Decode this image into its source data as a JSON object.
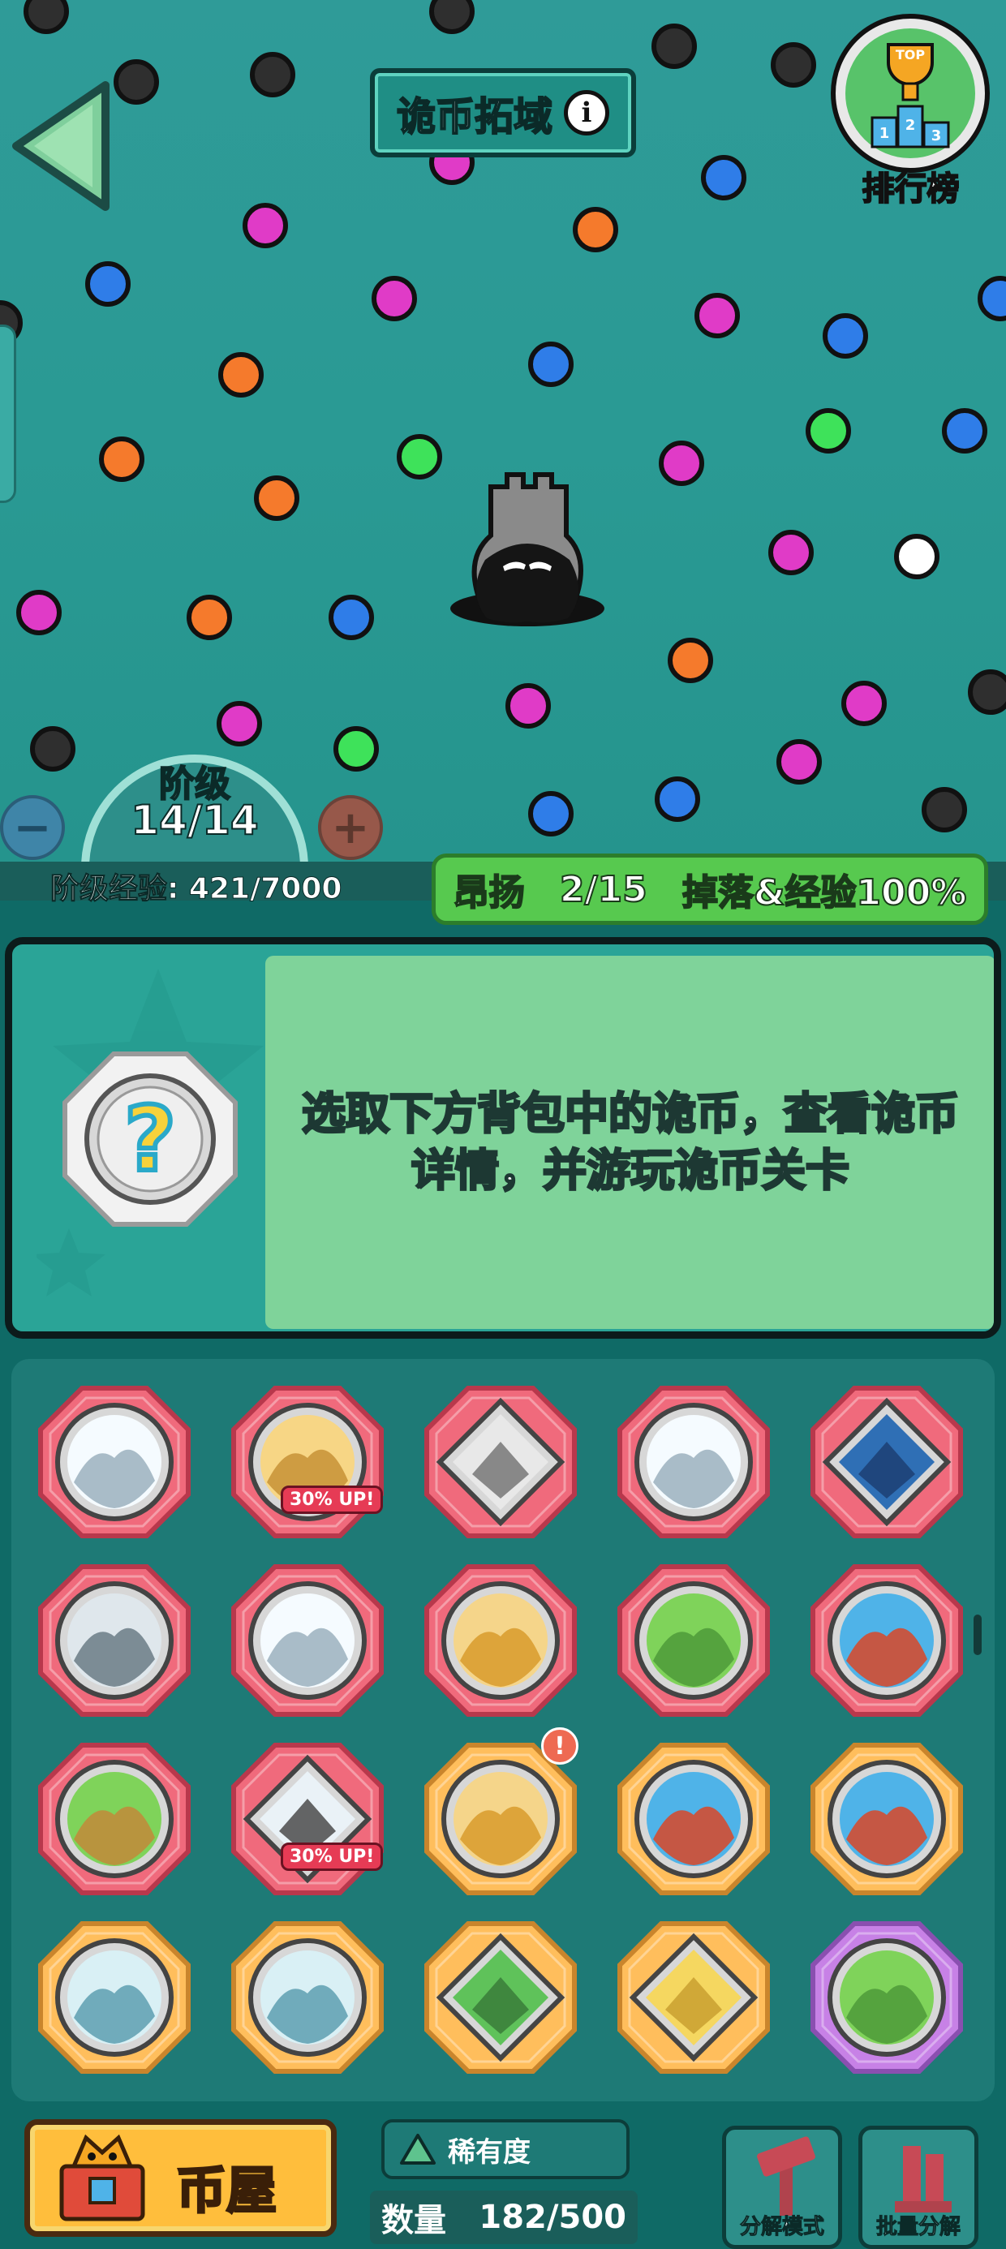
{
  "header": {
    "title": "诡币拓域",
    "leaderboard_label": "排行榜",
    "leaderboard_badge": "TOP",
    "podium_numbers": [
      "1",
      "2",
      "3"
    ]
  },
  "stage": {
    "label": "阶级",
    "value": "14/14",
    "exp_text": "阶级经验: 421/7000",
    "exp_current": 421,
    "exp_max": 7000
  },
  "buff": {
    "name": "昂扬",
    "progress": "2/15",
    "effect": "掉落&经验100%"
  },
  "info_panel": {
    "prompt": "选取下方背包中的诡币，查看诡币详情，并游玩诡币关卡"
  },
  "coins": [
    {
      "theme": "snow-tower",
      "rarity": "red",
      "shape": "circle",
      "badge": "",
      "alert": ""
    },
    {
      "theme": "sphinx",
      "rarity": "red",
      "shape": "circle",
      "badge": "30% UP!",
      "alert": ""
    },
    {
      "theme": "ruined-building",
      "rarity": "red",
      "shape": "diamond",
      "badge": "",
      "alert": ""
    },
    {
      "theme": "snow-tower",
      "rarity": "red",
      "shape": "circle",
      "badge": "",
      "alert": ""
    },
    {
      "theme": "flooded-city",
      "rarity": "red",
      "shape": "diamond",
      "badge": "",
      "alert": ""
    },
    {
      "theme": "graveyard-tower",
      "rarity": "red",
      "shape": "circle",
      "badge": "",
      "alert": ""
    },
    {
      "theme": "snow-tower",
      "rarity": "red",
      "shape": "circle",
      "badge": "",
      "alert": ""
    },
    {
      "theme": "pyramids",
      "rarity": "red",
      "shape": "circle",
      "badge": "",
      "alert": ""
    },
    {
      "theme": "grassland",
      "rarity": "red",
      "shape": "circle",
      "badge": "",
      "alert": ""
    },
    {
      "theme": "volcano",
      "rarity": "red",
      "shape": "circle",
      "badge": "",
      "alert": ""
    },
    {
      "theme": "scarecrow-field",
      "rarity": "red",
      "shape": "circle",
      "badge": "",
      "alert": ""
    },
    {
      "theme": "snowy-gallows",
      "rarity": "red",
      "shape": "diamond",
      "badge": "30% UP!",
      "alert": ""
    },
    {
      "theme": "pyramids",
      "rarity": "orange",
      "shape": "circle",
      "badge": "",
      "alert": "!"
    },
    {
      "theme": "volcano",
      "rarity": "orange",
      "shape": "circle",
      "badge": "",
      "alert": ""
    },
    {
      "theme": "volcano",
      "rarity": "orange",
      "shape": "circle",
      "badge": "",
      "alert": ""
    },
    {
      "theme": "snow-mountain",
      "rarity": "orange",
      "shape": "circle",
      "badge": "",
      "alert": ""
    },
    {
      "theme": "snow-mountain",
      "rarity": "orange",
      "shape": "circle",
      "badge": "",
      "alert": ""
    },
    {
      "theme": "jungle-tower",
      "rarity": "orange",
      "shape": "diamond",
      "badge": "",
      "alert": ""
    },
    {
      "theme": "ancient-temple",
      "rarity": "orange",
      "shape": "diamond",
      "badge": "",
      "alert": ""
    },
    {
      "theme": "grassland",
      "rarity": "purple",
      "shape": "circle",
      "badge": "",
      "alert": ""
    }
  ],
  "bottom_bar": {
    "coin_house_label": "币屋",
    "rarity_label": "稀有度",
    "count_label": "数量",
    "count_value": "182/500",
    "disassemble_mode_label": "分解模式",
    "batch_disassemble_label": "批量分解"
  },
  "colors": {
    "field_bg": "#2a9a94",
    "rarity_red": "#f06a7c",
    "rarity_orange": "#ffbe5c",
    "rarity_purple": "#c781e6",
    "buff_green": "#57c94f"
  }
}
